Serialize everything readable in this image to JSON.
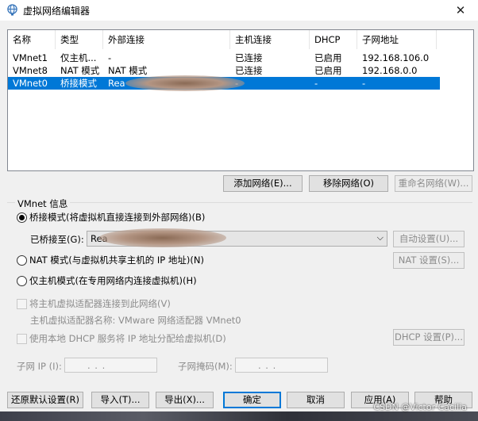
{
  "window": {
    "title": "虚拟网络编辑器",
    "close": "✕"
  },
  "table": {
    "headers": [
      "名称",
      "类型",
      "外部连接",
      "主机连接",
      "DHCP",
      "子网地址"
    ],
    "rows": [
      [
        "VMnet1",
        "仅主机...",
        "-",
        "已连接",
        "已启用",
        "192.168.106.0"
      ],
      [
        "VMnet8",
        "NAT 模式",
        "NAT 模式",
        "已连接",
        "已启用",
        "192.168.0.0"
      ],
      [
        "VMnet0",
        "桥接模式",
        "Rea",
        "-",
        "-",
        "-"
      ]
    ]
  },
  "list_buttons": {
    "add": "添加网络(E)...",
    "remove": "移除网络(O)",
    "rename": "重命名网络(W)..."
  },
  "vmnet_info": {
    "group_label": "VMnet 信息",
    "bridged_label": "桥接模式(将虚拟机直接连接到外部网络)(B)",
    "bridged_to_label": "已桥接至(G):",
    "bridged_to_value": "Rea",
    "auto_settings": "自动设置(U)...",
    "nat_label": "NAT 模式(与虚拟机共享主机的 IP 地址)(N)",
    "nat_settings": "NAT 设置(S)...",
    "host_only_label": "仅主机模式(在专用网络内连接虚拟机)(H)",
    "connect_adapter_label": "将主机虚拟适配器连接到此网络(V)",
    "adapter_name_label": "主机虚拟适配器名称: VMware 网络适配器 VMnet0",
    "dhcp_label": "使用本地 DHCP 服务将 IP 地址分配给虚拟机(D)",
    "dhcp_settings": "DHCP 设置(P)...",
    "subnet_ip_label": "子网 IP (I):",
    "subnet_mask_label": "子网掩码(M):",
    "ip_dots": ".      .      ."
  },
  "footer_buttons": {
    "restore": "还原默认设置(R)",
    "import": "导入(T)...",
    "export": "导出(X)...",
    "ok": "确定",
    "cancel": "取消",
    "apply": "应用(A)",
    "help": "帮助"
  },
  "watermark": "CSDN @Victor Cacilia",
  "colors": {
    "selection": "#0078d7",
    "accent": "#0078d7"
  }
}
